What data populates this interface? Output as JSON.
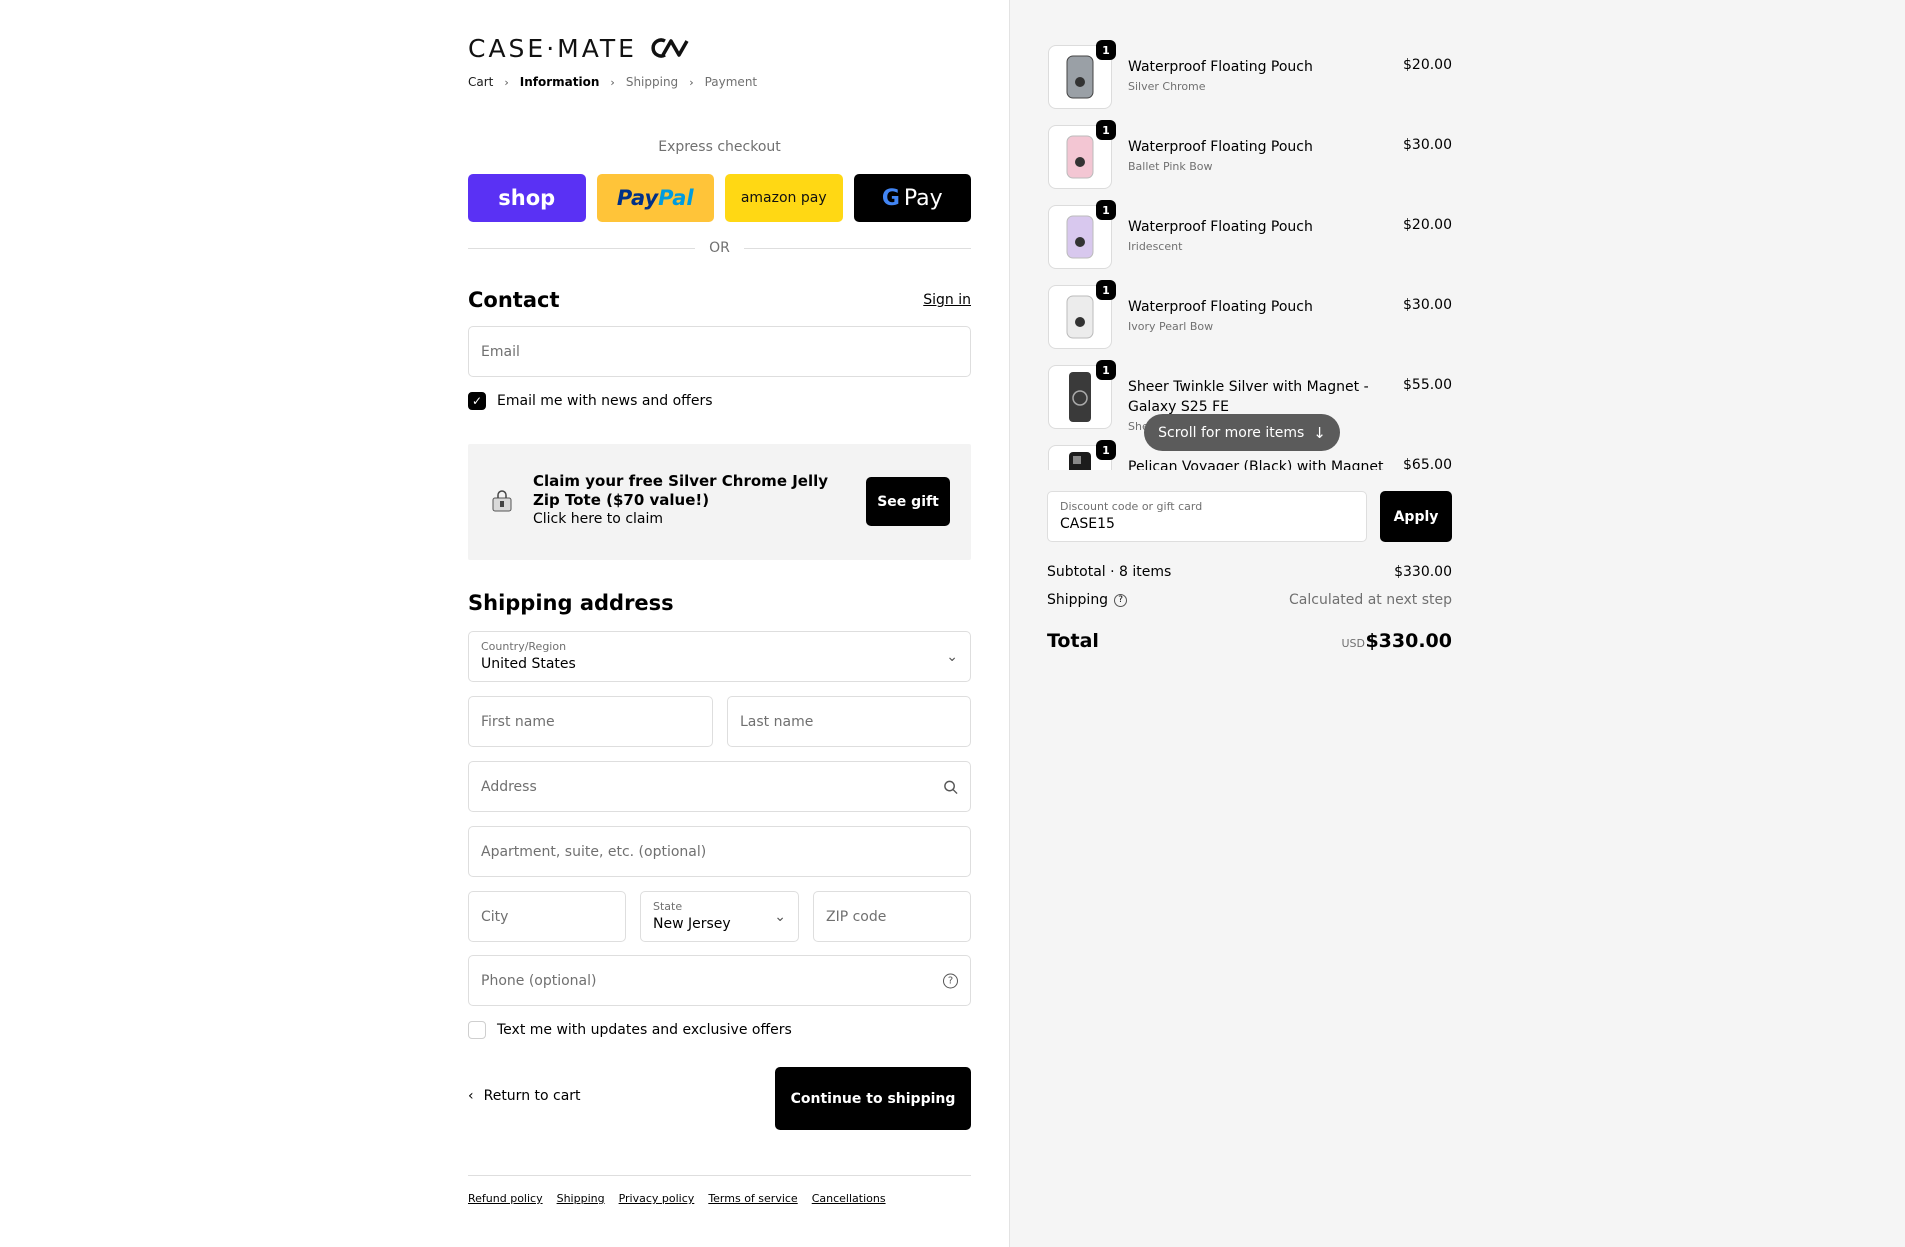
{
  "brand": {
    "logo_text": "CASE·MATE"
  },
  "breadcrumb": [
    {
      "label": "Cart",
      "state": "link"
    },
    {
      "label": "Information",
      "state": "current"
    },
    {
      "label": "Shipping",
      "state": "upcoming"
    },
    {
      "label": "Payment",
      "state": "upcoming"
    }
  ],
  "express": {
    "title": "Express checkout",
    "shop_label": "shop",
    "paypal_a": "Pay",
    "paypal_b": "Pal",
    "amazon_label": "amazon pay",
    "gpay_label": "Pay",
    "or_text": "OR"
  },
  "contact": {
    "title": "Contact",
    "sign_in": "Sign in",
    "email_placeholder": "Email",
    "news_label": "Email me with news and offers",
    "news_checked": true
  },
  "gift": {
    "title": "Claim your free Silver Chrome Jelly Zip Tote ($70 value!)",
    "subtitle": "Click here to claim",
    "button": "See gift"
  },
  "shipping": {
    "title": "Shipping address",
    "country_label": "Country/Region",
    "country_value": "United States",
    "first_name_placeholder": "First name",
    "last_name_placeholder": "Last name",
    "address_placeholder": "Address",
    "apt_placeholder": "Apartment, suite, etc. (optional)",
    "city_placeholder": "City",
    "state_label": "State",
    "state_value": "New Jersey",
    "zip_placeholder": "ZIP code",
    "phone_placeholder": "Phone (optional)",
    "sms_label": "Text me with updates and exclusive offers",
    "sms_checked": false
  },
  "actions": {
    "return_label": "Return to cart",
    "continue_label": "Continue to shipping"
  },
  "footer": [
    "Refund policy",
    "Shipping",
    "Privacy policy",
    "Terms of service",
    "Cancellations"
  ],
  "order": {
    "items": [
      {
        "qty": "1",
        "name": "Waterproof Floating Pouch",
        "variant": "Silver Chrome",
        "price": "$20.00",
        "color": "#9aa0a6"
      },
      {
        "qty": "1",
        "name": "Waterproof Floating Pouch",
        "variant": "Ballet Pink Bow",
        "price": "$30.00",
        "color": "#f3c6d3"
      },
      {
        "qty": "1",
        "name": "Waterproof Floating Pouch",
        "variant": "Iridescent",
        "price": "$20.00",
        "color": "#d8c8ee"
      },
      {
        "qty": "1",
        "name": "Waterproof Floating Pouch",
        "variant": "Ivory Pearl Bow",
        "price": "$30.00",
        "color": "#e8e8e8"
      },
      {
        "qty": "1",
        "name": "Sheer Twinkle Silver with Magnet - Galaxy S25 FE",
        "variant": "She",
        "price": "$55.00",
        "color": "#3a3a3a"
      },
      {
        "qty": "1",
        "name": "Pelican Voyager (Black) with Magnet",
        "variant": "",
        "price": "$65.00",
        "color": "#1c1c1c"
      }
    ],
    "scroll_hint": "Scroll for more items",
    "discount_label": "Discount code or gift card",
    "discount_value": "CASE15",
    "apply_label": "Apply",
    "subtotal_label": "Subtotal · 8 items",
    "subtotal_value": "$330.00",
    "shipping_label": "Shipping",
    "shipping_value": "Calculated at next step",
    "total_label": "Total",
    "total_currency": "USD",
    "total_value": "$330.00"
  }
}
